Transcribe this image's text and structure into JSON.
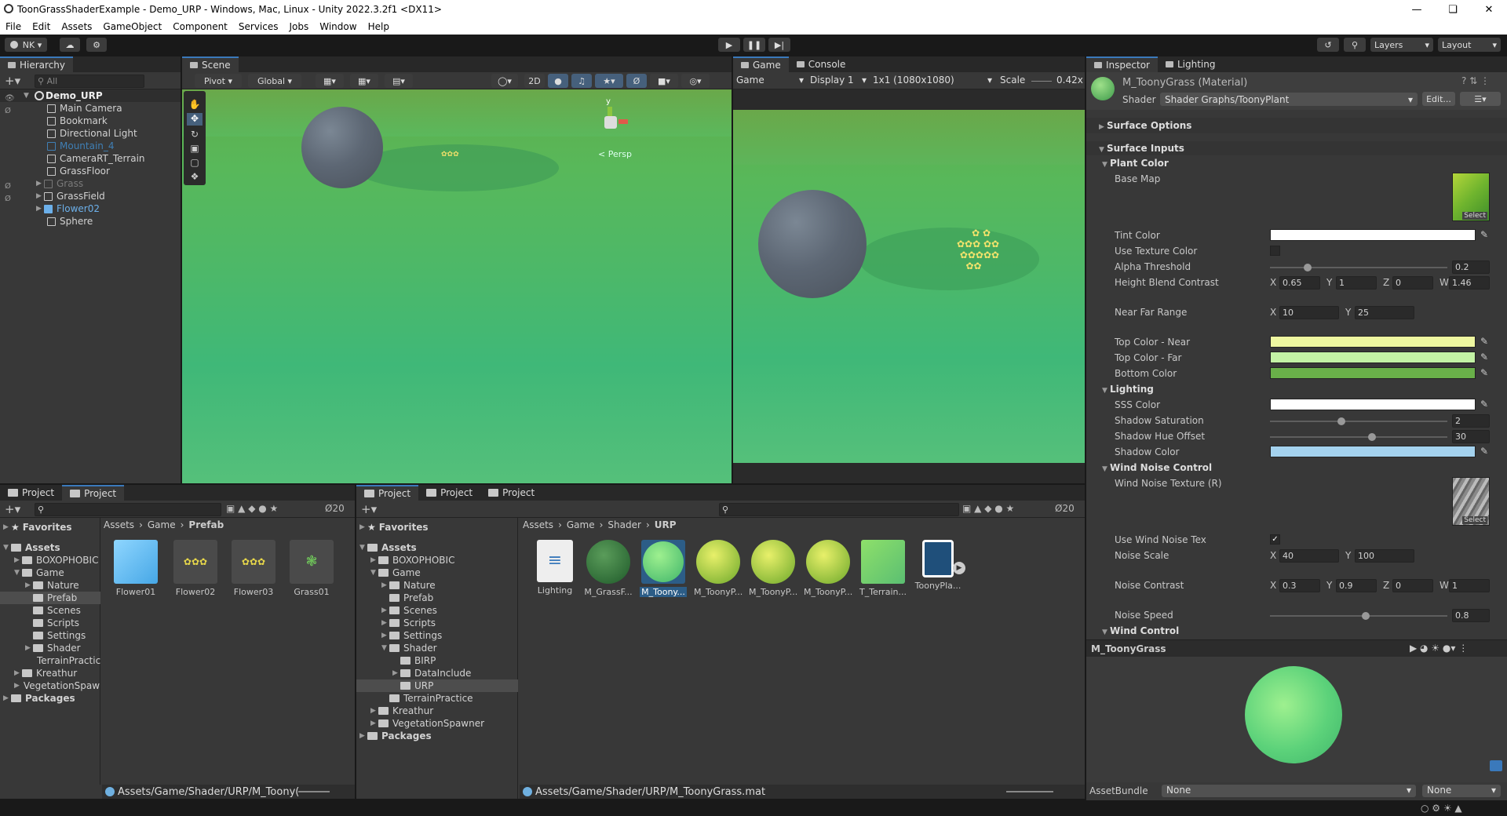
{
  "window": {
    "title": "ToonGrassShaderExample - Demo_URP - Windows, Mac, Linux - Unity 2022.3.2f1 <DX11>"
  },
  "menu": [
    "File",
    "Edit",
    "Assets",
    "GameObject",
    "Component",
    "Services",
    "Jobs",
    "Window",
    "Help"
  ],
  "toolbar": {
    "account": "NK",
    "layers": "Layers",
    "layout": "Layout"
  },
  "hierarchy": {
    "tab": "Hierarchy",
    "search_placeholder": "All",
    "scene": "Demo_URP",
    "items": [
      "Main Camera",
      "Bookmark",
      "Directional Light",
      "Mountain_4",
      "CameraRT_Terrain",
      "GrassFloor",
      "Grass",
      "GrassField",
      "Flower02",
      "Sphere"
    ]
  },
  "scene_view": {
    "tab": "Scene",
    "pivot": "Pivot",
    "global": "Global",
    "mode2d": "2D",
    "persp": "< Persp",
    "gizmo_y": "y"
  },
  "game_view": {
    "tab": "Game",
    "console_tab": "Console",
    "game_label": "Game",
    "display": "Display 1",
    "resolution": "1x1 (1080x1080)",
    "scale_label": "Scale",
    "scale_value": "0.42x"
  },
  "project_left": {
    "tabs": [
      "Project",
      "Project"
    ],
    "count": "20",
    "favorites": "Favorites",
    "assets": "Assets",
    "tree": [
      "BOXOPHOBIC",
      "Game",
      "Nature",
      "Prefab",
      "Scenes",
      "Scripts",
      "Settings",
      "Shader",
      "TerrainPractice",
      "Kreathur",
      "VegetationSpawner"
    ],
    "packages": "Packages",
    "breadcrumb": [
      "Assets",
      "Game",
      "Prefab"
    ],
    "files": [
      "Flower01",
      "Flower02",
      "Flower03",
      "Grass01"
    ],
    "path": "Assets/Game/Shader/URP/M_Toony("
  },
  "project_right": {
    "tabs": [
      "Project",
      "Project",
      "Project"
    ],
    "count": "20",
    "favorites": "Favorites",
    "assets": "Assets",
    "tree": [
      "BOXOPHOBIC",
      "Game",
      "Nature",
      "Prefab",
      "Scenes",
      "Scripts",
      "Settings",
      "Shader",
      "BIRP",
      "DataInclude",
      "URP",
      "TerrainPractice",
      "Kreathur",
      "VegetationSpawner"
    ],
    "packages": "Packages",
    "breadcrumb": [
      "Assets",
      "Game",
      "Shader",
      "URP"
    ],
    "files": [
      "Lighting",
      "M_GrassF...",
      "M_Toony...",
      "M_ToonyP...",
      "M_ToonyP...",
      "M_ToonyP...",
      "T_Terrain...",
      "ToonyPla..."
    ],
    "path": "Assets/Game/Shader/URP/M_ToonyGrass.mat"
  },
  "inspector": {
    "tab": "Inspector",
    "lighting_tab": "Lighting",
    "material": "M_ToonyGrass (Material)",
    "shader_label": "Shader",
    "shader_value": "Shader Graphs/ToonyPlant",
    "edit": "Edit...",
    "surface_options": "Surface Options",
    "surface_inputs": "Surface Inputs",
    "plant_color": "Plant Color",
    "base_map": "Base Map",
    "select": "Select",
    "tint_color": "Tint Color",
    "use_texture_color": "Use Texture Color",
    "alpha_threshold": "Alpha Threshold",
    "alpha_threshold_value": "0.2",
    "height_blend": "Height Blend Contrast",
    "height_blend_vals": {
      "x": "0.65",
      "y": "1",
      "z": "0",
      "w": "1.46"
    },
    "near_far": "Near Far Range",
    "near_far_vals": {
      "x": "10",
      "y": "25"
    },
    "top_near": "Top Color - Near",
    "top_far": "Top Color - Far",
    "bottom": "Bottom Color",
    "lighting": "Lighting",
    "sss": "SSS Color",
    "shadow_sat": "Shadow Saturation",
    "shadow_sat_value": "2",
    "shadow_hue": "Shadow Hue Offset",
    "shadow_hue_value": "30",
    "shadow_color": "Shadow Color",
    "wind_noise": "Wind Noise Control",
    "wind_tex": "Wind Noise Texture (R)",
    "use_wind": "Use Wind Noise Tex",
    "noise_scale": "Noise Scale",
    "noise_scale_vals": {
      "x": "40",
      "y": "100"
    },
    "noise_contrast": "Noise Contrast",
    "noise_contrast_vals": {
      "x": "0.3",
      "y": "0.9",
      "z": "0",
      "w": "1"
    },
    "noise_speed": "Noise Speed",
    "noise_speed_value": "0.8",
    "wind_control": "Wind Control",
    "preview_name": "M_ToonyGrass",
    "assetbundle": "AssetBundle",
    "none1": "None",
    "none2": "None",
    "xyzw": {
      "x": "X",
      "y": "Y",
      "z": "Z",
      "w": "W"
    },
    "colors": {
      "tint": "#ffffff",
      "top_near": "#eef7a0",
      "top_far": "#c3f3a5",
      "bottom": "#69b049",
      "sss": "#ffffff",
      "shadow": "#a4d2ee"
    },
    "slider_levels": {
      "alpha_threshold": 0.2,
      "shadow_saturation": 0.4,
      "shadow_hue_offset": 0.58,
      "noise_speed": 0.54
    }
  }
}
